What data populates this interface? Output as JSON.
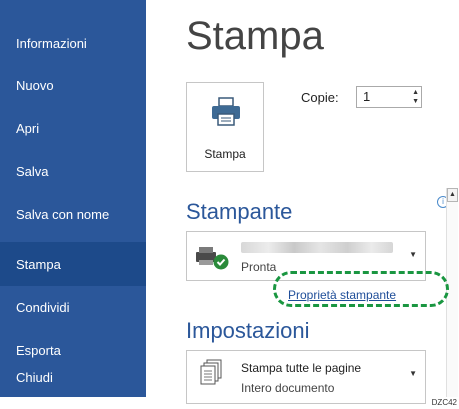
{
  "sidebar": {
    "items": [
      {
        "label": "Informazioni"
      },
      {
        "label": "Nuovo"
      },
      {
        "label": "Apri"
      },
      {
        "label": "Salva"
      },
      {
        "label": "Salva con nome"
      },
      {
        "label": "Stampa",
        "active": true
      },
      {
        "label": "Condividi"
      },
      {
        "label": "Esporta"
      },
      {
        "label": "Chiudi"
      }
    ],
    "background": "#2b579a",
    "active_background": "#1d4a8a"
  },
  "main": {
    "title": "Stampa",
    "print_button_label": "Stampa",
    "copies_label": "Copie:",
    "copies_value": "1",
    "printer_section": "Stampante",
    "printer_status": "Pronta",
    "printer_properties_link": "Proprietà stampante",
    "settings_section": "Impostazioni",
    "settings_dropdown": {
      "line1": "Stampa tutte le pagine",
      "line2": "Intero documento"
    }
  },
  "highlight_color": "#1a9641",
  "caption": "DZC42"
}
